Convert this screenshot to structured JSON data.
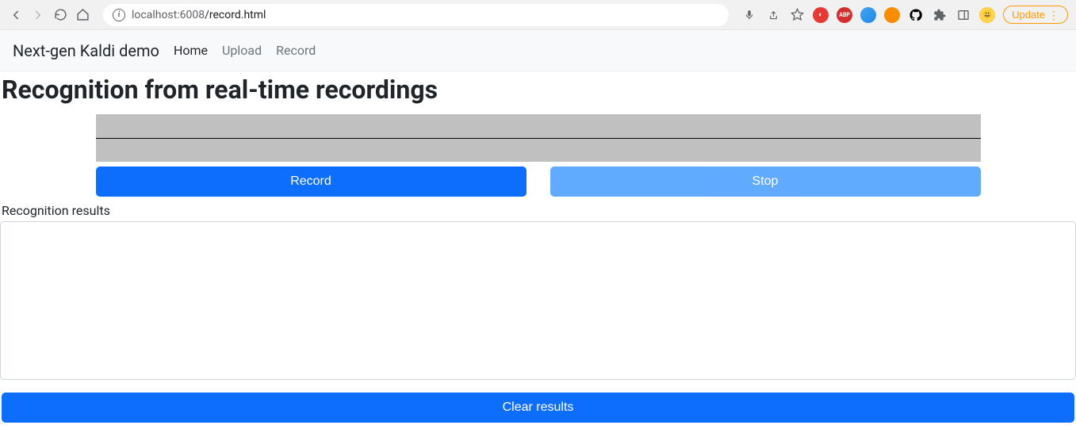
{
  "browser": {
    "url_host": "localhost:6008",
    "url_path": "/record.html",
    "update_label": "Update"
  },
  "navbar": {
    "brand": "Next-gen Kaldi demo",
    "links": [
      {
        "label": "Home",
        "active": true
      },
      {
        "label": "Upload",
        "active": false
      },
      {
        "label": "Record",
        "active": false
      }
    ]
  },
  "page": {
    "title": "Recognition from real-time recordings",
    "record_button": "Record",
    "stop_button": "Stop",
    "results_label": "Recognition results",
    "clear_button": "Clear results",
    "results_text": ""
  }
}
